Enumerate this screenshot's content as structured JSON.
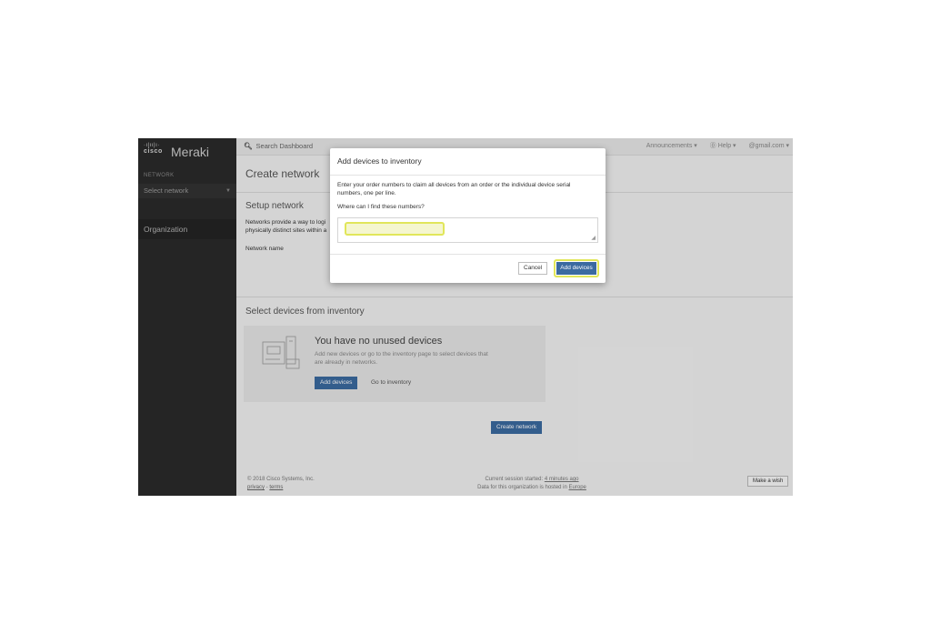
{
  "brand": {
    "cisco_bars": "·ı|ıı|ı·",
    "cisco": "cisco",
    "product": "Meraki"
  },
  "sidebar": {
    "section_label": "NETWORK",
    "network_select": "Select network",
    "organization": "Organization"
  },
  "topbar": {
    "search_placeholder": "Search Dashboard",
    "announcements": "Announcements ▾",
    "help": "⓪ Help ▾",
    "account": "@gmail.com ▾"
  },
  "page": {
    "title": "Create network",
    "setup_heading": "Setup network",
    "setup_desc_line1": "Networks provide a way to logi",
    "setup_desc_line2": "physically distinct sites within a",
    "network_name_label": "Network name",
    "select_heading": "Select devices from inventory"
  },
  "devices": {
    "empty_title": "You have no unused devices",
    "empty_desc": "Add new devices or go to the inventory page to select devices that are already in networks.",
    "add_button": "Add devices",
    "inventory_link": "Go to inventory"
  },
  "create_button": "Create network",
  "footer": {
    "copyright": "© 2018 Cisco Systems, Inc.",
    "privacy": "privacy",
    "terms": "terms",
    "session_prefix": "Current session started:",
    "session_time": "4 minutes ago",
    "hosted_prefix": "Data for this organization is hosted in",
    "hosted_region": "Europe",
    "wish_button": "Make a wish"
  },
  "modal": {
    "title": "Add devices to inventory",
    "description": "Enter your order numbers to claim all devices from an order or the individual device serial numbers, one per line.",
    "help_link": "Where can I find these numbers?",
    "textarea_value": "",
    "cancel_button": "Cancel",
    "add_button": "Add devices"
  },
  "colors": {
    "primary": "#3b6aa0",
    "highlight": "#e1e65a",
    "sidebar": "#2b2b2b"
  }
}
